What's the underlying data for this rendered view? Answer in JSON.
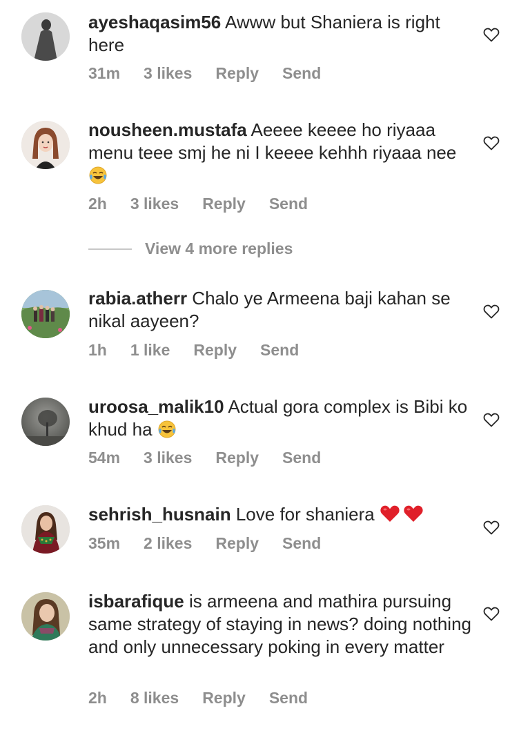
{
  "comments": [
    {
      "username": "ayeshaqasim56",
      "text": " Awww but Shaniera is right here",
      "time": "31m",
      "likes": "3 likes",
      "reply": "Reply",
      "send": "Send"
    },
    {
      "username": "nousheen.mustafa",
      "text": " Aeeee keeee ho riyaaa menu teee smj he ni I keeee kehhh riyaaa nee",
      "time": "2h",
      "likes": "3 likes",
      "reply": "Reply",
      "send": "Send"
    },
    {
      "username": "rabia.atherr",
      "text": " Chalo ye Armeena baji kahan se nikal aayeen?",
      "time": "1h",
      "likes": "1 like",
      "reply": "Reply",
      "send": "Send"
    },
    {
      "username": "uroosa_malik10",
      "text": " Actual gora complex is Bibi ko khud ha ",
      "time": "54m",
      "likes": "3 likes",
      "reply": "Reply",
      "send": "Send"
    },
    {
      "username": "sehrish_husnain",
      "text": " Love for shaniera ",
      "time": "35m",
      "likes": "2 likes",
      "reply": "Reply",
      "send": "Send"
    },
    {
      "username": "isbarafique",
      "text": " is armeena and mathira pursuing same strategy of staying in news? doing nothing and only unnecessary poking in every matter",
      "time": "2h",
      "likes": "8 likes",
      "reply": "Reply",
      "send": "Send"
    }
  ],
  "view_replies": "View 4 more replies",
  "icons": {
    "like": "heart-outline-icon",
    "laugh": "face-with-tears-of-joy-icon",
    "love": "red-heart-icon"
  },
  "colors": {
    "text": "#262626",
    "meta": "#8e8e8e",
    "heart_emoji": "#e0202a",
    "laugh_face": "#f7c33b"
  }
}
